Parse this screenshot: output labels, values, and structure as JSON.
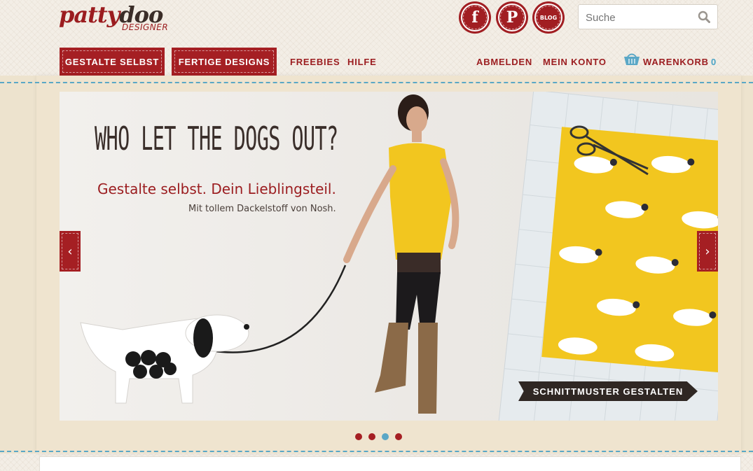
{
  "logo": {
    "brand_part1": "patty",
    "brand_part2": "doo",
    "sub": "DESIGNER"
  },
  "social": {
    "facebook": "f",
    "pinterest": "P",
    "blog": "BLOG"
  },
  "search": {
    "placeholder": "Suche"
  },
  "nav": {
    "tab_gestalte": "GESTALTE SELBST",
    "tab_fertige": "FERTIGE DESIGNS",
    "freebies": "FREEBIES",
    "hilfe": "HILFE",
    "abmelden": "ABMELDEN",
    "mein_konto": "MEIN KONTO",
    "warenkorb": "WARENKORB",
    "cart_count": "0"
  },
  "slider": {
    "headline": "WHO LET THE DOGS OUT?",
    "subline": "Gestalte selbst. Dein Lieblingsteil.",
    "smalline": "Mit tollem Dackelstoff von Nosh.",
    "cta": "SCHNITTMUSTER GESTALTEN",
    "prev": "‹",
    "next": "›",
    "active_slide": 3,
    "slide_count": 4
  },
  "colors": {
    "brand_red": "#a51f23",
    "accent_blue": "#5aa7c6",
    "fabric_yellow": "#f2c61f"
  }
}
